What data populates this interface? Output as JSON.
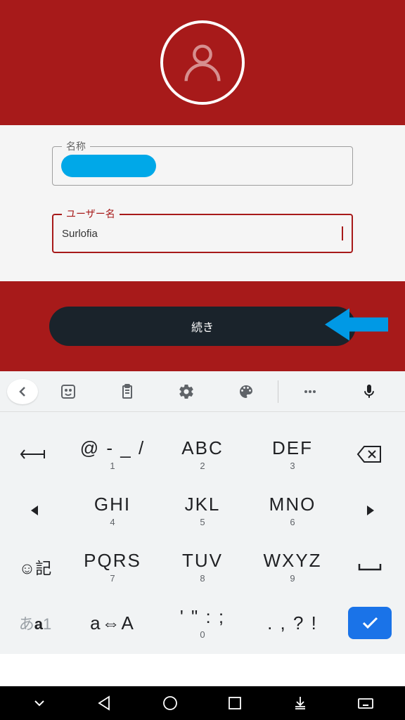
{
  "form": {
    "name_label": "名称",
    "username_label": "ユーザー名",
    "username_value": "Surlofia"
  },
  "button": {
    "continue_label": "続き"
  },
  "keyboard": {
    "rows": [
      [
        {
          "type": "arrow-left-return"
        },
        {
          "main": "@ - _ /",
          "sub": "1"
        },
        {
          "main": "ABC",
          "sub": "2"
        },
        {
          "main": "DEF",
          "sub": "3"
        },
        {
          "type": "backspace"
        }
      ],
      [
        {
          "type": "nav-left"
        },
        {
          "main": "GHI",
          "sub": "4"
        },
        {
          "main": "JKL",
          "sub": "5"
        },
        {
          "main": "MNO",
          "sub": "6"
        },
        {
          "type": "nav-right"
        }
      ],
      [
        {
          "type": "emoji",
          "main": "☺記"
        },
        {
          "main": "PQRS",
          "sub": "7"
        },
        {
          "main": "TUV",
          "sub": "8"
        },
        {
          "main": "WXYZ",
          "sub": "9"
        },
        {
          "type": "space"
        }
      ],
      [
        {
          "type": "lang",
          "main": "あa1"
        },
        {
          "main": "a⇔A",
          "sub": ""
        },
        {
          "main": "' \" : ;",
          "sub": "0"
        },
        {
          "main": ". , ? !",
          "sub": ""
        },
        {
          "type": "enter"
        }
      ]
    ]
  },
  "colors": {
    "accent": "#a71a1a",
    "blue": "#00a8e8",
    "dark_button": "#1a232b",
    "arrow": "#0099e5",
    "enter_blue": "#1a73e8"
  }
}
